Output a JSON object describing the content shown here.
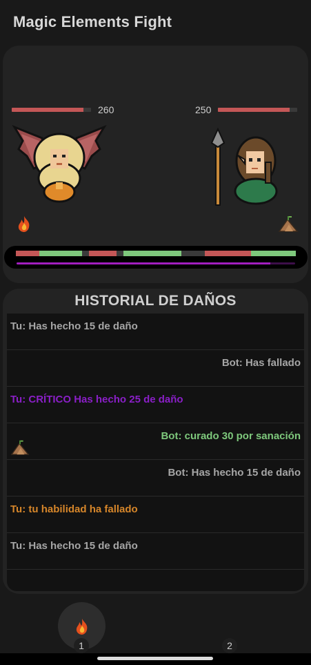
{
  "app": {
    "title": "Magic Elements Fight"
  },
  "colors": {
    "hp_bar": "#c45757",
    "turn_red": "#c45757",
    "turn_green": "#7ec87c",
    "turn_dark": "#3a3a3a",
    "mana": "#a21ec0",
    "log_default": "#a6a6a6",
    "log_critical": "#8a1fc7",
    "log_heal": "#7ec87c",
    "log_fail": "#d6862a"
  },
  "player": {
    "hp": "260",
    "hp_fraction": 0.9,
    "avatar_icon": "winged-blonde-mage-icon",
    "element_icon": "fire-icon"
  },
  "bot": {
    "hp": "250",
    "hp_fraction": 0.9,
    "avatar_icon": "elf-spear-warrior-icon",
    "element_icon": "earth-icon"
  },
  "turn_track": {
    "segments": [
      "red",
      "green",
      "dark",
      "red",
      "dark",
      "green",
      "dark",
      "red",
      "green"
    ],
    "mana_fraction": 0.91
  },
  "history": {
    "title": "HISTORIAL DE DAÑOS",
    "entries": [
      {
        "text": "Tu: Has hecho 15 de daño",
        "side": "left",
        "kind": "default",
        "icon": ""
      },
      {
        "text": "Bot: Has fallado",
        "side": "right",
        "kind": "default",
        "icon": ""
      },
      {
        "text": "Tu: CRÍTICO Has hecho 25 de daño",
        "side": "left",
        "kind": "critical",
        "icon": ""
      },
      {
        "text": "Bot: curado 30 por sanación",
        "side": "right",
        "kind": "heal",
        "icon": "earth-icon"
      },
      {
        "text": "Bot: Has hecho 15 de daño",
        "side": "right",
        "kind": "default",
        "icon": ""
      },
      {
        "text": "Tu: tu habilidad ha fallado",
        "side": "left",
        "kind": "fail",
        "icon": ""
      },
      {
        "text": "Tu: Has hecho 15 de daño",
        "side": "left",
        "kind": "default",
        "icon": ""
      }
    ]
  },
  "skills": [
    {
      "number": "1",
      "icon": "fire-icon"
    },
    {
      "number": "2",
      "icon": ""
    }
  ]
}
